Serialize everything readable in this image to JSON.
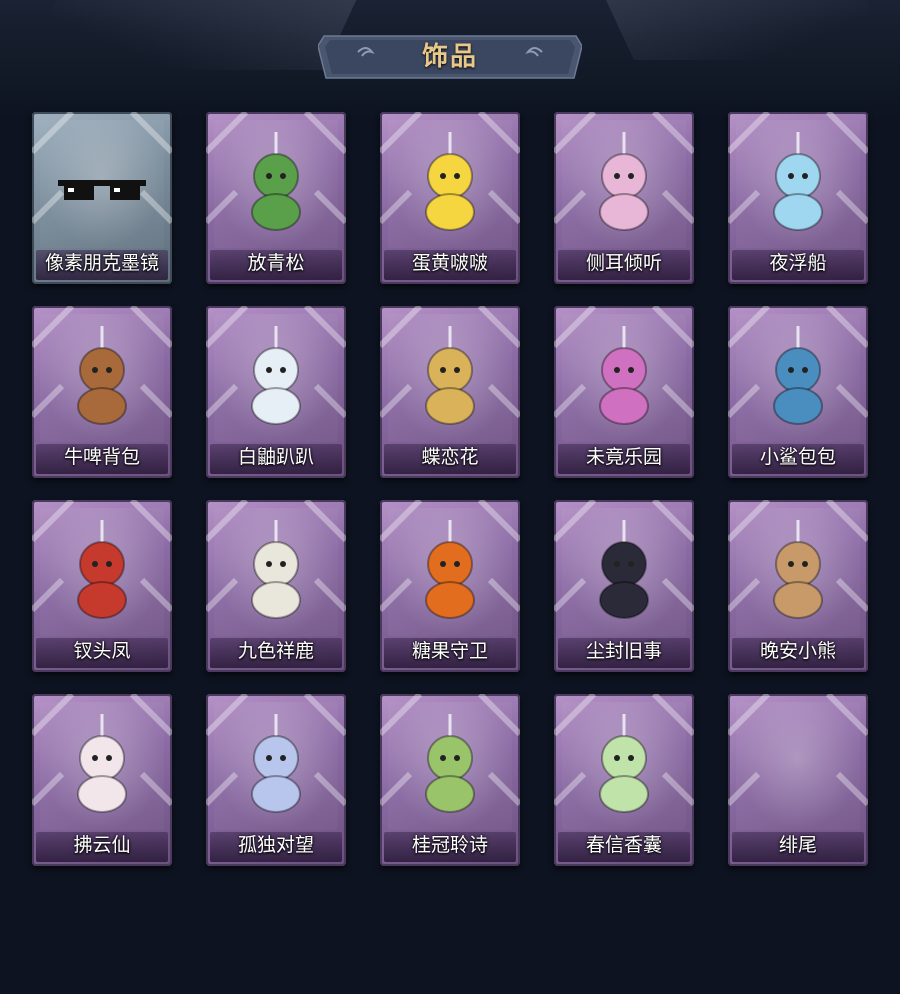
{
  "header": {
    "title": "饰品"
  },
  "items": [
    {
      "label": "像素朋克墨镜",
      "icon": "pixel-sunglasses-icon",
      "frame": "blue"
    },
    {
      "label": "放青松",
      "icon": "potted-pine-icon",
      "frame": "purple"
    },
    {
      "label": "蛋黄啵啵",
      "icon": "egg-chick-icon",
      "frame": "purple"
    },
    {
      "label": "侧耳倾听",
      "icon": "flower-wreath-icon",
      "frame": "purple"
    },
    {
      "label": "夜浮船",
      "icon": "jellyfish-icon",
      "frame": "purple"
    },
    {
      "label": "牛啤背包",
      "icon": "cow-beer-mug-icon",
      "frame": "purple"
    },
    {
      "label": "白鼬趴趴",
      "icon": "white-weasel-icon",
      "frame": "purple"
    },
    {
      "label": "蝶恋花",
      "icon": "butterfly-bell-icon",
      "frame": "purple"
    },
    {
      "label": "未竟乐园",
      "icon": "jester-doll-icon",
      "frame": "purple"
    },
    {
      "label": "小鲨包包",
      "icon": "shark-bag-icon",
      "frame": "purple"
    },
    {
      "label": "钗头凤",
      "icon": "phoenix-crown-doll-icon",
      "frame": "purple"
    },
    {
      "label": "九色祥鹿",
      "icon": "deer-charm-icon",
      "frame": "purple"
    },
    {
      "label": "糖果守卫",
      "icon": "pumpkin-scarecrow-icon",
      "frame": "purple"
    },
    {
      "label": "尘封旧事",
      "icon": "gentleman-doll-icon",
      "frame": "purple"
    },
    {
      "label": "晚安小熊",
      "icon": "teddy-bear-icon",
      "frame": "purple"
    },
    {
      "label": "拂云仙",
      "icon": "fox-fairy-doll-icon",
      "frame": "purple"
    },
    {
      "label": "孤独对望",
      "icon": "moon-doll-icon",
      "frame": "purple"
    },
    {
      "label": "桂冠聆诗",
      "icon": "laurel-poet-doll-icon",
      "frame": "purple"
    },
    {
      "label": "春信香囊",
      "icon": "jade-sachet-icon",
      "frame": "purple"
    },
    {
      "label": "绯尾",
      "icon": "empty-charm-icon",
      "frame": "purple"
    }
  ],
  "colors": {
    "background": "#0d1320",
    "title": "#e8c98a",
    "frame_purple": "#8a6aa3",
    "frame_blue": "#7b8d9c"
  }
}
